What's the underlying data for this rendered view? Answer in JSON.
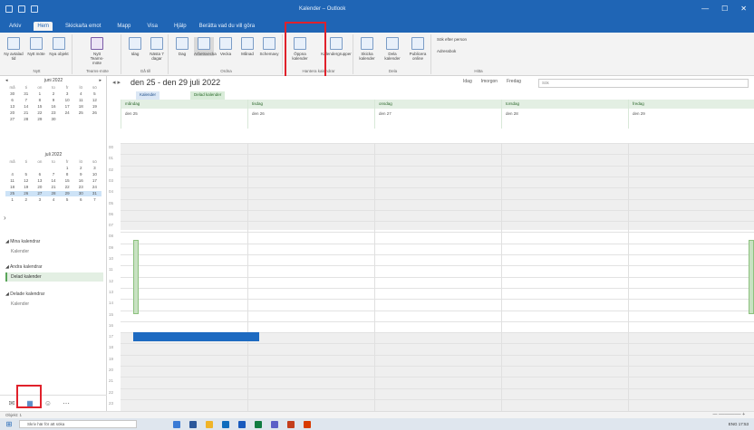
{
  "titlebar": {
    "title": "Kalender – Outlook"
  },
  "menu": {
    "tabs": [
      "Arkiv",
      "Hem",
      "Skicka/ta emot",
      "Mapp",
      "Visa",
      "Hjälp"
    ],
    "active_index": 1,
    "tell_me": "Berätta vad du vill göra"
  },
  "ribbon": {
    "groups": [
      {
        "label": "Nytt",
        "buttons": [
          "Ny avtalad tid",
          "Nytt möte",
          "Nya objekt"
        ]
      },
      {
        "label": "Teams-möte",
        "buttons": [
          "Nytt Teams-möte"
        ]
      },
      {
        "label": "Gå till",
        "buttons": [
          "Idag",
          "Nästa 7 dagar"
        ]
      },
      {
        "label": "Ordna",
        "buttons": [
          "Dag",
          "Arbetsvecka",
          "Vecka",
          "Månad",
          "Schemavy"
        ]
      },
      {
        "label": "Hantera kalendrar",
        "buttons": [
          "Öppna kalender",
          "Kalendergrupper"
        ]
      },
      {
        "label": "Dela",
        "buttons": [
          "Skicka kalender",
          "Dela kalender",
          "Publicera online"
        ]
      },
      {
        "label": "Hitta",
        "buttons": [
          "Sök efter person",
          "Adressbok"
        ]
      }
    ]
  },
  "leftpane": {
    "calendar1": {
      "month": "juni 2022",
      "weekdays": [
        "må",
        "ti",
        "on",
        "to",
        "fr",
        "lö",
        "sö"
      ],
      "rows": [
        [
          "30",
          "31",
          "1",
          "2",
          "3",
          "4",
          "5"
        ],
        [
          "6",
          "7",
          "8",
          "9",
          "10",
          "11",
          "12"
        ],
        [
          "13",
          "14",
          "15",
          "16",
          "17",
          "18",
          "19"
        ],
        [
          "20",
          "21",
          "22",
          "23",
          "24",
          "25",
          "26"
        ],
        [
          "27",
          "28",
          "29",
          "30",
          "",
          "",
          ""
        ]
      ]
    },
    "calendar2": {
      "month": "juli 2022",
      "weekdays": [
        "må",
        "ti",
        "on",
        "to",
        "fr",
        "lö",
        "sö"
      ],
      "rows": [
        [
          "",
          "",
          "",
          "",
          "1",
          "2",
          "3"
        ],
        [
          "4",
          "5",
          "6",
          "7",
          "8",
          "9",
          "10"
        ],
        [
          "11",
          "12",
          "13",
          "14",
          "15",
          "16",
          "17"
        ],
        [
          "18",
          "19",
          "20",
          "21",
          "22",
          "23",
          "24"
        ],
        [
          "25",
          "26",
          "27",
          "28",
          "29",
          "30",
          "31"
        ],
        [
          "1",
          "2",
          "3",
          "4",
          "5",
          "6",
          "7"
        ]
      ],
      "selected_row": 4
    },
    "groups": [
      {
        "head": "◢ Mina kalendrar",
        "items": [
          {
            "label": "Kalender",
            "checked": false
          }
        ]
      },
      {
        "head": "◢ Andra kalendrar",
        "items": [
          {
            "label": "Delad kalender",
            "checked": true
          }
        ]
      },
      {
        "head": "◢ Delade kalendrar",
        "items": [
          {
            "label": "Kalender",
            "checked": false
          }
        ]
      }
    ]
  },
  "calendar": {
    "range": "den 25 - den 29 juli 2022",
    "weather": [
      "Idag",
      "Imorgon",
      "Fredag"
    ],
    "search_placeholder": "Sök",
    "tabs": [
      "Kalender",
      "Delad kalender"
    ],
    "days": [
      {
        "name": "måndag",
        "date": "den 25"
      },
      {
        "name": "tisdag",
        "date": "den 26"
      },
      {
        "name": "onsdag",
        "date": "den 27"
      },
      {
        "name": "torsdag",
        "date": "den 28"
      },
      {
        "name": "fredag",
        "date": "den 29"
      }
    ],
    "hours": [
      "00",
      "01",
      "02",
      "03",
      "04",
      "05",
      "06",
      "07",
      "08",
      "09",
      "10",
      "11",
      "12",
      "13",
      "14",
      "15",
      "16",
      "17",
      "18",
      "19",
      "20",
      "21",
      "22",
      "23"
    ]
  },
  "statusbar": {
    "left": "Objekt: 1",
    "right": "— ─────── +"
  },
  "taskbar": {
    "search_placeholder": "Skriv här för att söka",
    "tray": "ENG 17:53"
  },
  "colors": {
    "accent": "#1f65b5",
    "highlight": "#e0212b",
    "event": "#1d6ac1",
    "shared": "#5aa55a"
  }
}
